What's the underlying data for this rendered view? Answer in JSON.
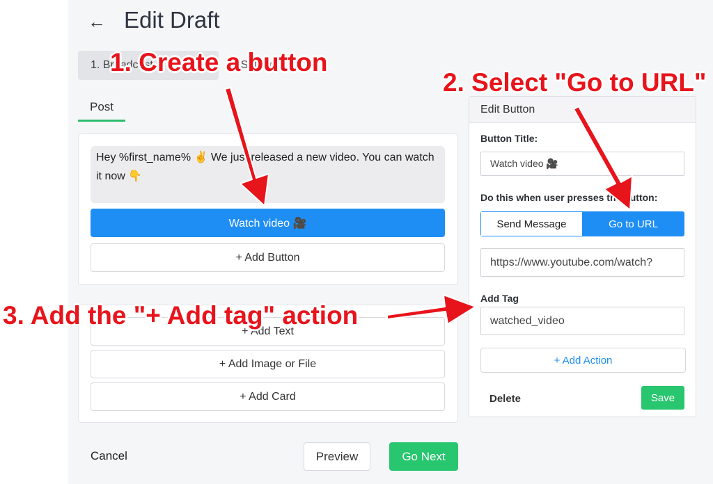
{
  "header": {
    "back_icon": "←",
    "title": "Edit Draft"
  },
  "breadcrumb": {
    "step_active": "1. Broadcast",
    "step_next": "2. Settings"
  },
  "tabs": [
    {
      "label": "Post"
    }
  ],
  "message": {
    "text": "Hey %first_name% ✌️ We just released a new video. You can watch it now 👇",
    "button_label": "Watch video 🎥",
    "add_button_label": "+ Add Button"
  },
  "blocks": {
    "add_text": "+ Add Text",
    "add_image": "+ Add Image or File",
    "add_card": "+ Add Card"
  },
  "footer": {
    "cancel": "Cancel",
    "preview": "Preview",
    "go_next": "Go Next"
  },
  "edit_button": {
    "title": "Edit Button",
    "button_title_label": "Button Title:",
    "button_title_value": "Watch video 🎥",
    "action_label": "Do this when user presses the button:",
    "options": [
      "Send Message",
      "Go to URL"
    ],
    "url_value": "https://www.youtube.com/watch?",
    "add_tag_label": "Add Tag",
    "tag_value": "watched_video",
    "add_action": "+ Add Action",
    "delete": "Delete",
    "save": "Save"
  },
  "annotations": {
    "step1": "1. Create a button",
    "step2": "2. Select \"Go to URL\"",
    "step3": "3. Add the \"+ Add tag\" action"
  },
  "colors": {
    "primary": "#1e8ef5",
    "success": "#28c66f",
    "tab_underline": "#2ebd6e",
    "annotation": "#e8141c"
  }
}
